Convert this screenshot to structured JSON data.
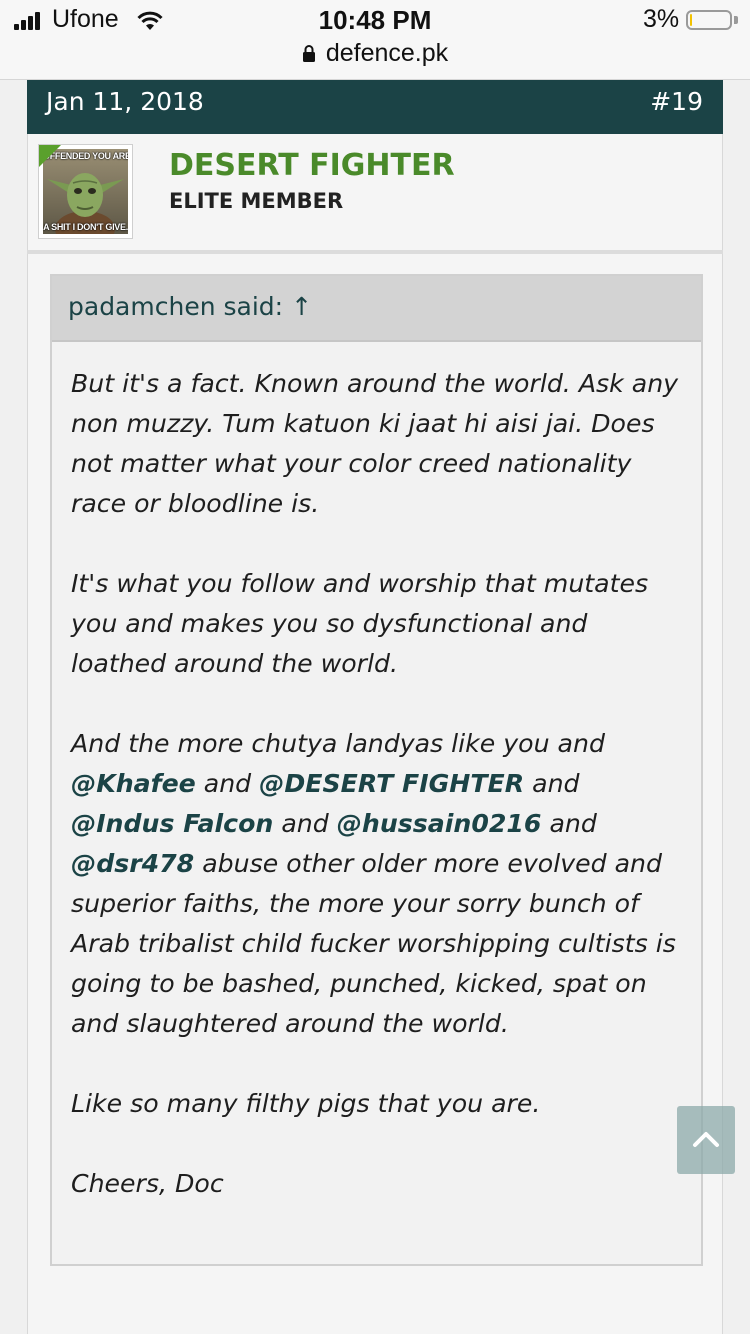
{
  "status_bar": {
    "carrier": "Ufone",
    "time": "10:48 PM",
    "battery": "3%",
    "battery_level": 0.03,
    "url": "defence.pk"
  },
  "post": {
    "date": "Jan 11, 2018",
    "number": "#19",
    "author": {
      "name": "DESERT FIGHTER",
      "title": "ELITE MEMBER",
      "avatar_caption_top": "OFFENDED YOU ARE?",
      "avatar_caption_bottom": "A SHIT I DON'T GIVE."
    },
    "quote": {
      "author": "padamchen said:",
      "arrow": "↑",
      "p1": "But it's a fact. Known around the world. Ask any non muzzy. Tum katuon ki jaat hi aisi jai. Does not matter what your color creed nationality race or bloodline is.",
      "p2": "It's what you follow and worship that mutates you and makes you so dysfunctional and loathed around the world.",
      "p3_a": "And the more chutya landyas like you and ",
      "mention1": "@Khafee",
      "p3_b": " and ",
      "mention2": "@DESERT FIGHTER",
      "p3_c": " and ",
      "mention3": "@Indus Falcon",
      "p3_d": " and ",
      "mention4": "@hussain0216",
      "p3_e": " and ",
      "mention5": "@dsr478",
      "p3_f": " abuse other older more evolved and superior faiths, the more your sorry bunch of Arab tribalist child fucker worshipping cultists is going to be bashed, punched, kicked, spat on and slaughtered around the world.",
      "p4": "Like so many filthy pigs that you are.",
      "p5": "Cheers, Doc"
    }
  },
  "icons": {
    "signal": "cellular-signal-icon",
    "wifi": "wifi-icon",
    "battery": "battery-icon",
    "lock": "lock-icon",
    "scroll_top": "chevron-up-icon"
  },
  "colors": {
    "header_bg": "#1b4346",
    "username": "#4a8a2a",
    "mention": "#1b4346",
    "battery_fill": "#f2c200"
  }
}
